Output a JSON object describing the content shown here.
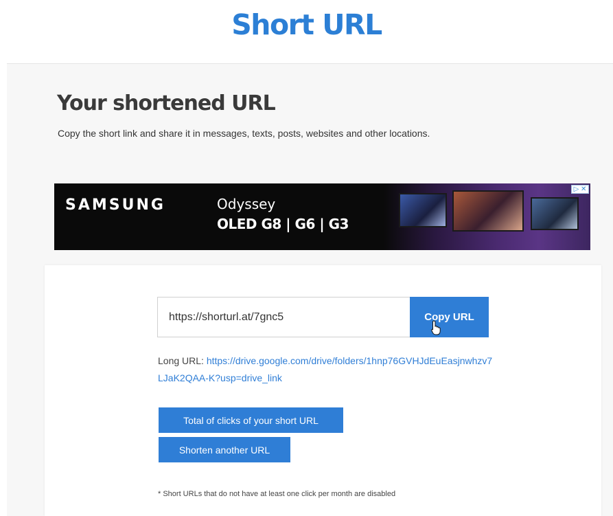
{
  "header": {
    "title": "Short URL"
  },
  "result": {
    "heading": "Your shortened URL",
    "description": "Copy the short link and share it in messages, texts, posts, websites and other locations."
  },
  "ad": {
    "brand": "SAMSUNG",
    "line1": "Odyssey",
    "line2": "OLED G8 | G6 | G3",
    "close_glyph": "▷ ✕"
  },
  "short_url": {
    "value": "https://shorturl.at/7gnc5",
    "copy_label": "Copy URL"
  },
  "long_url": {
    "label": "Long URL:",
    "value": "https://drive.google.com/drive/folders/1hnp76GVHJdEuEasjnwhzv7LJaK2QAA-K?usp=drive_link"
  },
  "actions": {
    "total_clicks_label": "Total of clicks of your short URL",
    "shorten_another_label": "Shorten another URL"
  },
  "footnote": "* Short URLs that do not have at least one click per month are disabled",
  "colors": {
    "brand": "#2c7fd5",
    "button": "#2f7ed6"
  }
}
